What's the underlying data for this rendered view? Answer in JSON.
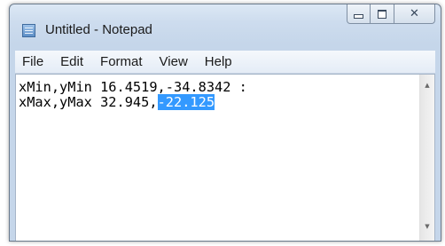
{
  "window": {
    "title": "Untitled - Notepad",
    "icon": "notepad-icon"
  },
  "caption_buttons": {
    "minimize_icon": "minimize-icon",
    "maximize_icon": "maximize-icon",
    "close_icon": "close-icon",
    "close_glyph": "✕"
  },
  "menu": {
    "items": [
      {
        "label": "File"
      },
      {
        "label": "Edit"
      },
      {
        "label": "Format"
      },
      {
        "label": "View"
      },
      {
        "label": "Help"
      }
    ]
  },
  "editor": {
    "line1": "xMin,yMin 16.4519,-34.8342 :",
    "line2_prefix": "xMax,yMax 32.945,",
    "line2_selected": "-22.125",
    "selection_color": "#3399ff"
  },
  "scrollbar": {
    "up_glyph": "▲",
    "down_glyph": "▼"
  }
}
